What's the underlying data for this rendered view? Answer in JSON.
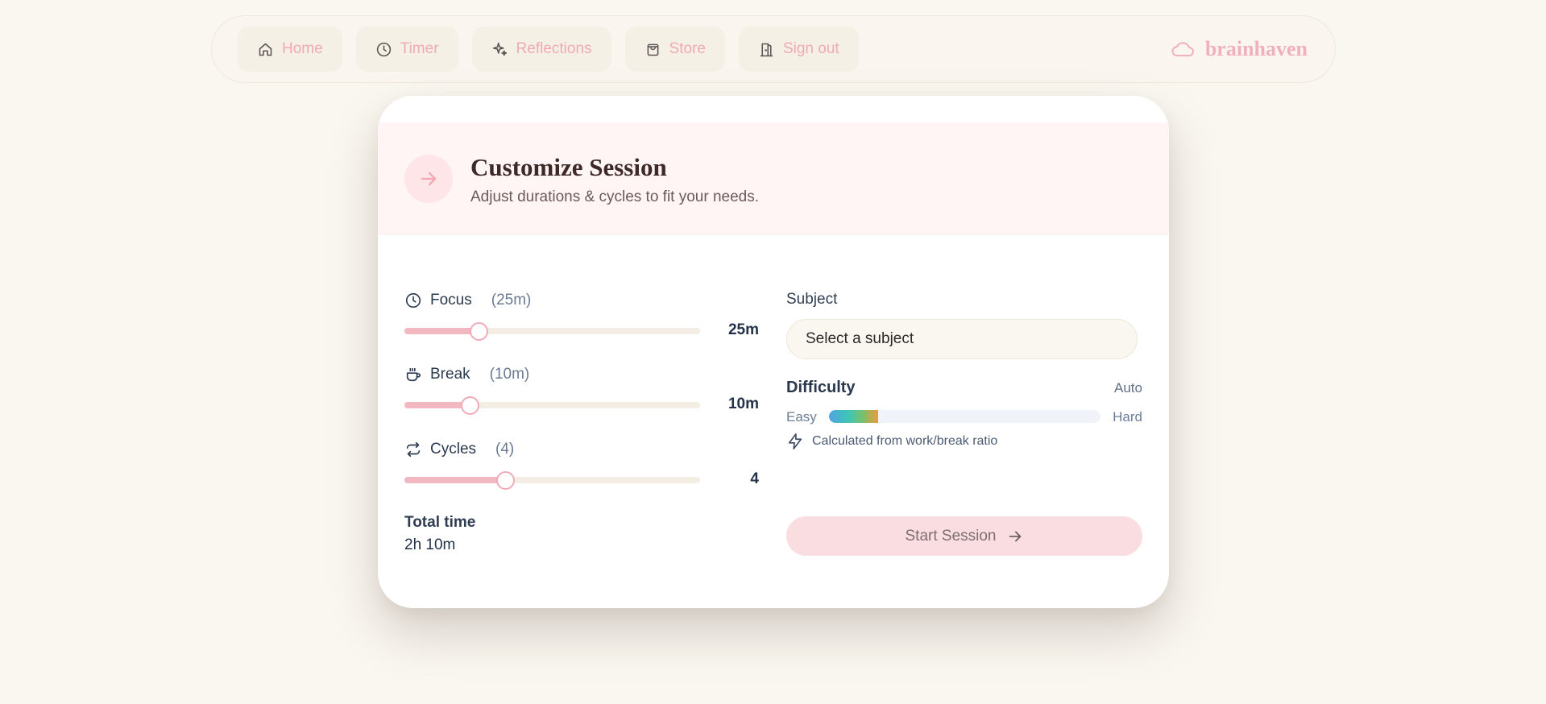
{
  "nav": {
    "items": [
      {
        "label": "Home",
        "icon": "home-icon"
      },
      {
        "label": "Timer",
        "icon": "clock-icon"
      },
      {
        "label": "Reflections",
        "icon": "sparkles-icon"
      },
      {
        "label": "Store",
        "icon": "shopping-bag-icon"
      },
      {
        "label": "Sign out",
        "icon": "door-exit-icon"
      }
    ],
    "brand": "brainhaven",
    "brand_icon": "cloud-icon"
  },
  "header": {
    "title": "Customize Session",
    "subtitle": "Adjust durations & cycles to fit your needs.",
    "icon": "arrow-right-icon"
  },
  "sliders": {
    "focus": {
      "label": "Focus",
      "paren": "(25m)",
      "value": "25m",
      "fraction": 0.25,
      "icon": "clock-icon"
    },
    "break": {
      "label": "Break",
      "paren": "(10m)",
      "value": "10m",
      "fraction": 0.22,
      "icon": "coffee-cup-icon"
    },
    "cycles": {
      "label": "Cycles",
      "paren": "(4)",
      "value": "4",
      "fraction": 0.34,
      "icon": "repeat-icon"
    }
  },
  "total": {
    "label": "Total time",
    "value": "2h 10m"
  },
  "subject": {
    "label": "Subject",
    "selected": "Select a subject"
  },
  "difficulty": {
    "label": "Difficulty",
    "mode": "Auto",
    "easy": "Easy",
    "hard": "Hard",
    "level": 0.18,
    "note": "Calculated from work/break ratio",
    "note_icon": "lightning-icon"
  },
  "start_button": {
    "label": "Start Session",
    "icon": "arrow-right-icon"
  },
  "colors": {
    "accent": "#f1b8c2",
    "background": "#faf7f0",
    "header_bg": "#fff5f5"
  }
}
